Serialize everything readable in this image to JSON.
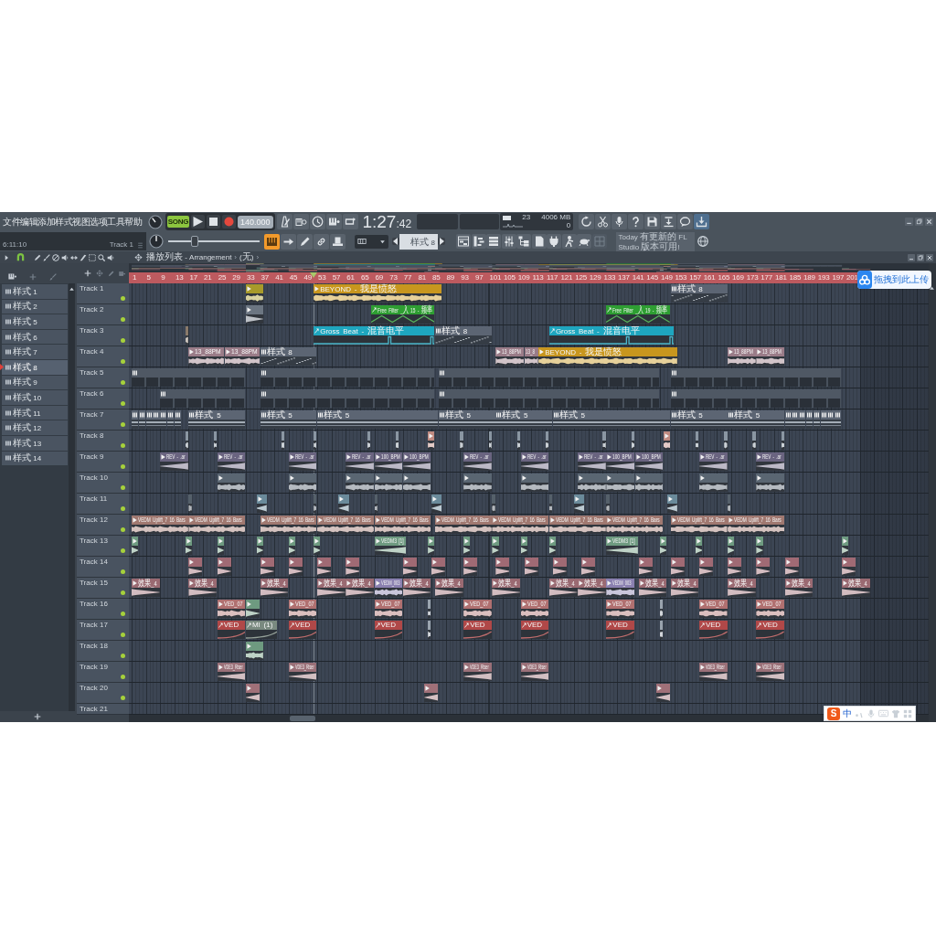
{
  "menu": [
    {
      "label": "文件"
    },
    {
      "label": "编辑"
    },
    {
      "label": "添加"
    },
    {
      "label": "样式"
    },
    {
      "label": "视图"
    },
    {
      "label": "选项"
    },
    {
      "label": "工具"
    },
    {
      "label": "帮助"
    }
  ],
  "transport": {
    "mode": "SONG",
    "tempo": "140.000"
  },
  "time": {
    "main": "1:27",
    "sub": ":42"
  },
  "performance": {
    "cpu": "23",
    "memory": "4006 MB",
    "polyphony": "0"
  },
  "hint_bar": {
    "time": "6:11:10",
    "target": "Track 1"
  },
  "pitch": {
    "level": 0.27
  },
  "typing_keyboard": {
    "on": true
  },
  "pattern_selector": {
    "value": "样式 8"
  },
  "news": "Today 有更新的 FL Studio 版本可用!",
  "patterns": [
    {
      "name": "样式 1",
      "selected": false
    },
    {
      "name": "样式 2",
      "selected": false
    },
    {
      "name": "样式 5",
      "selected": false
    },
    {
      "name": "样式 6",
      "selected": false
    },
    {
      "name": "样式 7",
      "selected": false
    },
    {
      "name": "样式 8",
      "selected": true
    },
    {
      "name": "样式 9",
      "selected": false
    },
    {
      "name": "样式 10",
      "selected": false
    },
    {
      "name": "样式 11",
      "selected": false
    },
    {
      "name": "样式 12",
      "selected": false
    },
    {
      "name": "样式 13",
      "selected": false
    },
    {
      "name": "样式 14",
      "selected": false
    }
  ],
  "playlist": {
    "breadcrumb": [
      {
        "text": "播放列表 - Arrangement",
        "separator": "›"
      },
      {
        "text": "(无)",
        "separator": "›"
      }
    ],
    "ruler": [
      "1",
      "5",
      "9",
      "13",
      "17",
      "21",
      "25",
      "29",
      "33",
      "37",
      "41",
      "45",
      "49",
      "53",
      "57",
      "61",
      "65",
      "69",
      "73",
      "77",
      "81",
      "85",
      "89",
      "93",
      "97",
      "101",
      "105",
      "109",
      "113",
      "117",
      "121",
      "125",
      "129",
      "133",
      "137",
      "141",
      "145",
      "149",
      "153",
      "157",
      "161",
      "165",
      "169",
      "173",
      "177",
      "181",
      "185",
      "189",
      "193",
      "197",
      "201"
    ],
    "tracks": [
      {
        "name": "Track 1",
        "enabled": true,
        "clips": [
          {
            "kind": "wave",
            "color": "#a89a2a"
          },
          {
            "kind": "wave",
            "label": "BEYOND - 我是愤怒",
            "color": "#c8961e"
          },
          {
            "kind": "notes",
            "label": "样式 8",
            "color": "#5c6573"
          }
        ]
      },
      {
        "name": "Track 2",
        "enabled": true,
        "clips": [
          {
            "kind": "fade",
            "color": "#6c7682"
          },
          {
            "kind": "zigzag",
            "label": "Free Filter _入 15 - 频率",
            "color": "#2e9e32"
          },
          {
            "kind": "zigzag",
            "label": "Free Filter _入 19 - 频率",
            "color": "#2e9e32"
          }
        ]
      },
      {
        "name": "Track 3",
        "enabled": true,
        "clips": [
          {
            "kind": "wave",
            "color": "#8a7a6a"
          },
          {
            "kind": "pulse",
            "label": "Gross Beat - 混音电平",
            "color": "#1ea6bf"
          },
          {
            "kind": "notes",
            "label": "样式 8",
            "color": "#5c6573"
          },
          {
            "kind": "pulse",
            "label": "Gross Beat - 混音电平",
            "color": "#1ea6bf"
          }
        ]
      },
      {
        "name": "Track 4",
        "enabled": true,
        "clips": [
          {
            "kind": "wave",
            "label": "13_88PM",
            "color": "#9a7c88"
          },
          {
            "kind": "wave",
            "label": "13_88PM",
            "color": "#9a7c88"
          },
          {
            "kind": "notes",
            "label": "样式 8",
            "color": "#5c6573"
          },
          {
            "kind": "wave",
            "label": "13_88PM",
            "color": "#9a7c88"
          },
          {
            "kind": "wave",
            "label": "13_8",
            "color": "#9a7c88"
          },
          {
            "kind": "wave",
            "label": "BEYOND - 我是愤怒",
            "color": "#c8961e"
          },
          {
            "kind": "wave",
            "label": "13_88PM",
            "color": "#9a7c88"
          },
          {
            "kind": "wave",
            "label": "13_88PM",
            "color": "#9a7c88"
          }
        ]
      },
      {
        "name": "Track 5",
        "enabled": true,
        "clips": [
          {
            "kind": "blocks",
            "color": "#4f5864"
          },
          {
            "kind": "blocks",
            "color": "#4f5864"
          },
          {
            "kind": "blocks",
            "color": "#4f5864"
          },
          {
            "kind": "blocks",
            "color": "#4f5864"
          }
        ]
      },
      {
        "name": "Track 6",
        "enabled": true,
        "clips": [
          {
            "kind": "blocks",
            "color": "#4f5864"
          },
          {
            "kind": "blocks",
            "color": "#4f5864"
          },
          {
            "kind": "blocks",
            "color": "#4f5864"
          },
          {
            "kind": "blocks",
            "color": "#4f5864"
          }
        ]
      },
      {
        "name": "Track 7",
        "enabled": true,
        "clips": [
          {
            "kind": "band",
            "color": "#5c6573"
          },
          {
            "kind": "band",
            "color": "#5c6573"
          },
          {
            "kind": "band",
            "color": "#5c6573"
          },
          {
            "kind": "band",
            "color": "#5c6573"
          },
          {
            "kind": "band",
            "color": "#5c6573"
          },
          {
            "kind": "band",
            "color": "#5c6573"
          },
          {
            "kind": "band",
            "color": "#5c6573"
          },
          {
            "kind": "band",
            "label": "样式 5",
            "color": "#5c6573"
          },
          {
            "kind": "band",
            "label": "样式 5",
            "color": "#5c6573"
          },
          {
            "kind": "band",
            "label": "样式 5",
            "color": "#5c6573"
          },
          {
            "kind": "band",
            "label": "样式 5",
            "color": "#5c6573"
          },
          {
            "kind": "band",
            "label": "样式 5",
            "color": "#5c6573"
          },
          {
            "kind": "band",
            "label": "样式 5",
            "color": "#5c6573"
          },
          {
            "kind": "band",
            "label": "样式 5",
            "color": "#5c6573"
          },
          {
            "kind": "band",
            "label": "样式 5",
            "color": "#5c6573"
          },
          {
            "kind": "band",
            "color": "#5c6573"
          },
          {
            "kind": "band",
            "color": "#5c6573"
          },
          {
            "kind": "band",
            "color": "#5c6573"
          },
          {
            "kind": "band",
            "color": "#5c6573"
          },
          {
            "kind": "band",
            "color": "#5c6573"
          },
          {
            "kind": "band",
            "color": "#5c6573"
          },
          {
            "kind": "band",
            "color": "#5c6573"
          },
          {
            "kind": "band",
            "color": "#5c6573"
          }
        ]
      },
      {
        "name": "Track 8",
        "enabled": true,
        "clips": [
          {
            "kind": "wave",
            "color": "#8a96a2"
          },
          {
            "kind": "wave",
            "color": "#8a96a2"
          },
          {
            "kind": "wave",
            "color": "#8a96a2"
          },
          {
            "kind": "wave",
            "color": "#8a96a2"
          },
          {
            "kind": "wave",
            "color": "#8a96a2"
          },
          {
            "kind": "wave",
            "color": "#8a96a2"
          },
          {
            "kind": "wave",
            "color": "#c08a80"
          },
          {
            "kind": "wave",
            "color": "#8a96a2"
          },
          {
            "kind": "wave",
            "color": "#8a96a2"
          },
          {
            "kind": "wave",
            "color": "#8a96a2"
          },
          {
            "kind": "wave",
            "color": "#8a96a2"
          },
          {
            "kind": "wave",
            "color": "#8a96a2"
          },
          {
            "kind": "wave",
            "color": "#8a96a2"
          },
          {
            "kind": "wave",
            "color": "#c08a80"
          },
          {
            "kind": "wave",
            "color": "#8a96a2"
          },
          {
            "kind": "wave",
            "color": "#8a96a2"
          },
          {
            "kind": "wave",
            "color": "#8a96a2"
          },
          {
            "kind": "wave",
            "color": "#8a96a2"
          }
        ]
      },
      {
        "name": "Track 9",
        "enabled": true,
        "clips": [
          {
            "kind": "riser",
            "label": "REV - .ar",
            "color": "#6a6480"
          },
          {
            "kind": "riser",
            "label": "REV - .ar",
            "color": "#6a6480"
          },
          {
            "kind": "riser",
            "label": "REV - .ar",
            "color": "#6a6480"
          },
          {
            "kind": "riser",
            "label": "REV - .ar",
            "color": "#6a6480"
          },
          {
            "kind": "riser",
            "label": "100_BPM",
            "color": "#6a6480"
          },
          {
            "kind": "riser",
            "label": "100_BPM",
            "color": "#6a6480"
          },
          {
            "kind": "riser",
            "label": "REV - .ar",
            "color": "#6a6480"
          },
          {
            "kind": "riser",
            "label": "REV - .ar",
            "color": "#6a6480"
          },
          {
            "kind": "riser",
            "label": "REV - .ar",
            "color": "#6a6480"
          },
          {
            "kind": "riser",
            "label": "100_BPM",
            "color": "#6a6480"
          },
          {
            "kind": "riser",
            "label": "100_BPM",
            "color": "#6a6480"
          },
          {
            "kind": "riser",
            "label": "REV - .ar",
            "color": "#6a6480"
          },
          {
            "kind": "riser",
            "label": "REV - .ar",
            "color": "#6a6480"
          }
        ]
      },
      {
        "name": "Track 10",
        "enabled": true,
        "clips": [
          {
            "kind": "wave",
            "color": "#5a6672"
          },
          {
            "kind": "wave",
            "color": "#5a6672"
          },
          {
            "kind": "wave",
            "color": "#5a6672"
          },
          {
            "kind": "wave",
            "color": "#5a6672"
          },
          {
            "kind": "wave",
            "color": "#5a6672"
          },
          {
            "kind": "wave",
            "color": "#5a6672"
          },
          {
            "kind": "wave",
            "color": "#5a6672"
          },
          {
            "kind": "wave",
            "color": "#5a6672"
          },
          {
            "kind": "wave",
            "color": "#5a6672"
          },
          {
            "kind": "wave",
            "color": "#5a6672"
          },
          {
            "kind": "wave",
            "color": "#5a6672"
          },
          {
            "kind": "wave",
            "color": "#5a6672"
          }
        ]
      },
      {
        "name": "Track 11",
        "enabled": true,
        "clips": [
          {
            "kind": "wave",
            "color": "#55606a"
          },
          {
            "kind": "riser",
            "color": "#6a8a9a"
          },
          {
            "kind": "wave",
            "color": "#55606a"
          },
          {
            "kind": "riser",
            "color": "#6a8a9a"
          },
          {
            "kind": "wave",
            "color": "#55606a"
          },
          {
            "kind": "riser",
            "color": "#6a8a9a"
          },
          {
            "kind": "wave",
            "color": "#55606a"
          },
          {
            "kind": "wave",
            "color": "#55606a"
          },
          {
            "kind": "riser",
            "color": "#6a8a9a"
          },
          {
            "kind": "wave",
            "color": "#55606a"
          },
          {
            "kind": "riser",
            "color": "#6a8a9a"
          },
          {
            "kind": "wave",
            "color": "#55606a"
          }
        ]
      },
      {
        "name": "Track 12",
        "enabled": true,
        "clips": [
          {
            "kind": "wave",
            "label": "VEDM Uplift_7 16 Bars",
            "color": "#a07870"
          },
          {
            "kind": "wave",
            "label": "VEDM Uplift_7 16 Bars",
            "color": "#a07870"
          },
          {
            "kind": "wave",
            "label": "VEDM Uplift_7 16 Bars",
            "color": "#a07870"
          },
          {
            "kind": "wave",
            "label": "VEDM Uplift_7 16 Bars",
            "color": "#a07870"
          },
          {
            "kind": "wave",
            "label": "VEDM Uplift_7 16 Bars",
            "color": "#a07870"
          },
          {
            "kind": "wave",
            "label": "VEDM Uplift_7 16 Bars",
            "color": "#a07870"
          },
          {
            "kind": "wave",
            "label": "VEDM Uplift_7 16 Bars",
            "color": "#a07870"
          },
          {
            "kind": "wave",
            "label": "VEDM Uplift_7 16 Bars",
            "color": "#a07870"
          },
          {
            "kind": "wave",
            "label": "VEDM Uplift_7 16 Bars",
            "color": "#a07870"
          },
          {
            "kind": "wave",
            "label": "VEDM Uplift_7 16 Bars",
            "color": "#a07870"
          },
          {
            "kind": "wave",
            "label": "VEDM Uplift_7 16 Bars",
            "color": "#a07870"
          }
        ]
      },
      {
        "name": "Track 13",
        "enabled": true,
        "clips": [
          {
            "kind": "fade",
            "color": "#6e9a80"
          },
          {
            "kind": "fade",
            "color": "#6e9a80"
          },
          {
            "kind": "fade",
            "color": "#6e9a80"
          },
          {
            "kind": "fade",
            "color": "#6e9a80"
          },
          {
            "kind": "fade",
            "color": "#6e9a80"
          },
          {
            "kind": "fade",
            "color": "#6e9a80"
          },
          {
            "kind": "riser",
            "label": "VEDM3 [1]",
            "color": "#6e9a80"
          },
          {
            "kind": "fade",
            "color": "#6e9a80"
          },
          {
            "kind": "fade",
            "color": "#6e9a80"
          },
          {
            "kind": "fade",
            "color": "#6e9a80"
          },
          {
            "kind": "fade",
            "color": "#6e9a80"
          },
          {
            "kind": "fade",
            "color": "#6e9a80"
          },
          {
            "kind": "riser",
            "label": "VEDM3 [1]",
            "color": "#6e9a80"
          },
          {
            "kind": "fade",
            "color": "#6e9a80"
          },
          {
            "kind": "fade",
            "color": "#6e9a80"
          },
          {
            "kind": "fade",
            "color": "#6e9a80"
          },
          {
            "kind": "fade",
            "color": "#6e9a80"
          },
          {
            "kind": "fade",
            "color": "#6e9a80"
          }
        ]
      },
      {
        "name": "Track 14",
        "enabled": true,
        "clips": [
          {
            "kind": "fade",
            "color": "#a06a74"
          },
          {
            "kind": "fade",
            "color": "#a06a74"
          },
          {
            "kind": "fade",
            "color": "#a06a74"
          },
          {
            "kind": "fade",
            "color": "#a06a74"
          },
          {
            "kind": "fade",
            "color": "#a06a74"
          },
          {
            "kind": "fade",
            "color": "#a06a74"
          },
          {
            "kind": "fade",
            "color": "#a06a74"
          },
          {
            "kind": "fade",
            "color": "#a06a74"
          },
          {
            "kind": "fade",
            "color": "#a06a74"
          },
          {
            "kind": "fade",
            "color": "#a06a74"
          },
          {
            "kind": "fade",
            "color": "#a06a74"
          },
          {
            "kind": "fade",
            "color": "#a06a74"
          },
          {
            "kind": "fade",
            "color": "#a06a74"
          },
          {
            "kind": "fade",
            "color": "#a06a74"
          },
          {
            "kind": "fade",
            "color": "#a06a74"
          },
          {
            "kind": "fade",
            "color": "#a06a74"
          },
          {
            "kind": "fade",
            "color": "#a06a74"
          },
          {
            "kind": "fade",
            "color": "#a06a74"
          },
          {
            "kind": "fade",
            "color": "#a06a74"
          },
          {
            "kind": "fade",
            "color": "#a06a74"
          }
        ]
      },
      {
        "name": "Track 15",
        "enabled": true,
        "clips": [
          {
            "kind": "fade",
            "label": "效果_4",
            "color": "#9a6a72"
          },
          {
            "kind": "fade",
            "label": "效果_4",
            "color": "#9a6a72"
          },
          {
            "kind": "fade",
            "label": "效果_4",
            "color": "#9a6a72"
          },
          {
            "kind": "fade",
            "label": "效果_4",
            "color": "#9a6a72"
          },
          {
            "kind": "fade",
            "label": "效果_4",
            "color": "#9a6a72"
          },
          {
            "kind": "wave",
            "label": "VEDM_003",
            "color": "#8a80b0"
          },
          {
            "kind": "fade",
            "label": "效果_4",
            "color": "#9a6a72"
          },
          {
            "kind": "fade",
            "label": "效果_4",
            "color": "#9a6a72"
          },
          {
            "kind": "fade",
            "label": "效果_4",
            "color": "#9a6a72"
          },
          {
            "kind": "fade",
            "label": "效果_4",
            "color": "#9a6a72"
          },
          {
            "kind": "fade",
            "label": "效果_4",
            "color": "#9a6a72"
          },
          {
            "kind": "wave",
            "label": "VEDM_003",
            "color": "#8a80b0"
          },
          {
            "kind": "fade",
            "label": "效果_4",
            "color": "#9a6a72"
          },
          {
            "kind": "fade",
            "label": "效果_4",
            "color": "#9a6a72"
          },
          {
            "kind": "fade",
            "label": "效果_4",
            "color": "#9a6a72"
          },
          {
            "kind": "fade",
            "label": "效果_4",
            "color": "#9a6a72"
          },
          {
            "kind": "fade",
            "label": "效果_4",
            "color": "#9a6a72"
          }
        ]
      },
      {
        "name": "Track 16",
        "enabled": true,
        "clips": [
          {
            "kind": "wave",
            "label": "VED_07",
            "color": "#b07070"
          },
          {
            "kind": "fade",
            "color": "#6e9a80"
          },
          {
            "kind": "wave",
            "label": "VED_07",
            "color": "#b07070"
          },
          {
            "kind": "wave",
            "label": "VED_07",
            "color": "#b07070"
          },
          {
            "kind": "wave",
            "color": "#9aa4ae"
          },
          {
            "kind": "wave",
            "label": "VED_07",
            "color": "#b07070"
          },
          {
            "kind": "wave",
            "label": "VED_07",
            "color": "#b07070"
          },
          {
            "kind": "wave",
            "label": "VED_07",
            "color": "#b07070"
          },
          {
            "kind": "wave",
            "color": "#9aa4ae"
          },
          {
            "kind": "wave",
            "label": "VED_07",
            "color": "#b07070"
          },
          {
            "kind": "wave",
            "label": "VED_07",
            "color": "#b07070"
          }
        ]
      },
      {
        "name": "Track 17",
        "enabled": true,
        "clips": [
          {
            "kind": "ramp",
            "label": "VED",
            "color": "#b04848"
          },
          {
            "kind": "ramp",
            "label": "MI (1)",
            "color": "#7a8a80"
          },
          {
            "kind": "ramp",
            "label": "VED",
            "color": "#b04848"
          },
          {
            "kind": "ramp",
            "label": "VED",
            "color": "#b04848"
          },
          {
            "kind": "wave",
            "color": "#9aa4ae"
          },
          {
            "kind": "ramp",
            "label": "VED",
            "color": "#b04848"
          },
          {
            "kind": "ramp",
            "label": "VED",
            "color": "#b04848"
          },
          {
            "kind": "ramp",
            "label": "VED",
            "color": "#b04848"
          },
          {
            "kind": "wave",
            "color": "#9aa4ae"
          },
          {
            "kind": "ramp",
            "label": "VED",
            "color": "#b04848"
          },
          {
            "kind": "ramp",
            "label": "VED",
            "color": "#b04848"
          }
        ]
      },
      {
        "name": "Track 18",
        "enabled": true,
        "clips": [
          {
            "kind": "wave",
            "color": "#6e9a80"
          }
        ]
      },
      {
        "name": "Track 19",
        "enabled": true,
        "clips": [
          {
            "kind": "riser",
            "label": "VDE3_Riser",
            "color": "#9a7078"
          },
          {
            "kind": "riser",
            "label": "VDE3_Riser",
            "color": "#9a7078"
          },
          {
            "kind": "riser",
            "label": "VDE3_Riser",
            "color": "#9a7078"
          },
          {
            "kind": "riser",
            "label": "VDE3_Riser",
            "color": "#9a7078"
          },
          {
            "kind": "riser",
            "label": "VDE3_Riser",
            "color": "#9a7078"
          },
          {
            "kind": "riser",
            "label": "VDE3_Riser",
            "color": "#9a7078"
          }
        ]
      },
      {
        "name": "Track 20",
        "enabled": true,
        "clips": [
          {
            "kind": "riser",
            "color": "#a07078"
          },
          {
            "kind": "riser",
            "color": "#a07078"
          },
          {
            "kind": "riser",
            "color": "#a07078"
          }
        ]
      },
      {
        "name": "Track 21"
      }
    ]
  },
  "upload_button": {
    "label": "拖拽到此上传"
  },
  "ime": {
    "logo": "S",
    "mode": "中"
  }
}
